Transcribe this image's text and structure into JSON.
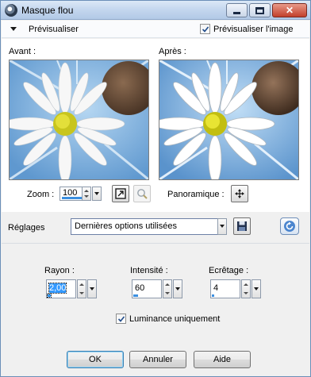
{
  "window": {
    "title": "Masque flou",
    "icon": "app-camera-icon",
    "controls": [
      "minimize-icon",
      "maximize-icon",
      "close-icon"
    ]
  },
  "preview_bar": {
    "label": "Prévisualiser",
    "checkbox_label": "Prévisualiser l'image",
    "checkbox_checked": true
  },
  "preview": {
    "before_label": "Avant :",
    "after_label": "Après :",
    "zoom_label": "Zoom :",
    "zoom_value": "100",
    "pan_label": "Panoramique :",
    "icons": [
      "fit-window-icon",
      "zoom-tool-icon",
      "pan-move-icon"
    ]
  },
  "settings": {
    "label": "Réglages",
    "preset_value": "Dernières options utilisées",
    "icons": [
      "save-preset-icon",
      "reset-icon"
    ]
  },
  "params": {
    "radius": {
      "label": "Rayon :",
      "value": "2,00"
    },
    "intensity": {
      "label": "Intensité :",
      "value": "60"
    },
    "clipping": {
      "label": "Ecrêtage :",
      "value": "4"
    }
  },
  "luminance": {
    "label": "Luminance uniquement",
    "checked": true
  },
  "buttons": {
    "ok": "OK",
    "cancel": "Annuler",
    "help": "Aide"
  },
  "colors": {
    "accent": "#3b8fe0",
    "selection": "#3399ff",
    "title_bar": "#c3d6ee",
    "close_button": "#c2402b"
  }
}
